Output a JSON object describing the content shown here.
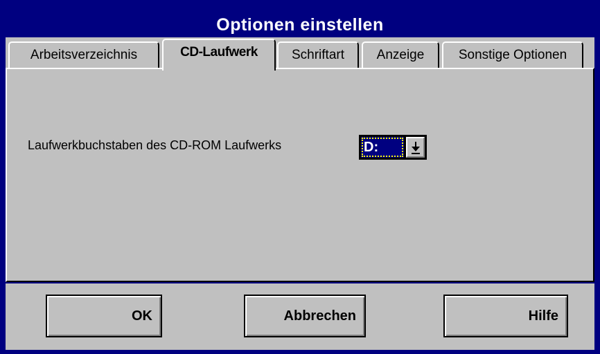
{
  "window": {
    "title": "Optionen einstellen"
  },
  "tabs": [
    {
      "label": "Arbeitsverzeichnis"
    },
    {
      "label": "CD-Laufwerk"
    },
    {
      "label": "Schriftart"
    },
    {
      "label": "Anzeige"
    },
    {
      "label": "Sonstige Optionen"
    }
  ],
  "active_tab": "CD-Laufwerk",
  "cd_panel": {
    "drive_label": "Laufwerkbuchstaben des CD-ROM Laufwerks",
    "drive_value": "D:"
  },
  "buttons": {
    "ok": "OK",
    "cancel": "Abbrechen",
    "help": "Hilfe"
  },
  "icons": {
    "combo_arrow": "dropdown-arrow-icon"
  },
  "colors": {
    "title_bg": "#000080",
    "dialog_bg": "#c0c0c0",
    "selection": "#000080",
    "focus": "#ffff00"
  }
}
